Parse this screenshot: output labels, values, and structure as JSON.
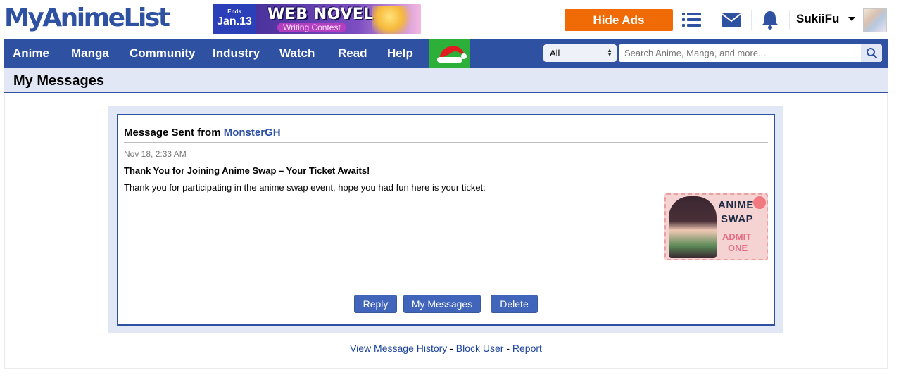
{
  "header": {
    "logo": "MyAnimeList",
    "banner": {
      "ends_label": "Ends",
      "ends_date": "Jan.13",
      "title": "WEB NOVEL",
      "subtitle": "Writing Contest"
    },
    "hide_ads_label": "Hide Ads",
    "username": "SukiiFu"
  },
  "nav": {
    "items": [
      "Anime",
      "Manga",
      "Community",
      "Industry",
      "Watch",
      "Read",
      "Help"
    ],
    "search_select": "All",
    "search_placeholder": "Search Anime, Manga, and more..."
  },
  "page": {
    "title": "My Messages"
  },
  "message": {
    "header_prefix": "Message Sent from ",
    "sender": "MonsterGH",
    "date": "Nov 18, 2:33 AM",
    "subject": "Thank You for Joining Anime Swap – Your Ticket Awaits!",
    "body": "Thank you for participating in the anime swap event, hope you had fun here is your ticket:",
    "ticket": {
      "line1": "ANIME",
      "line2": "SWAP",
      "line3": "ADMIT",
      "line4": "ONE"
    },
    "buttons": {
      "reply": "Reply",
      "my_messages": "My Messages",
      "delete": "Delete"
    }
  },
  "footer": {
    "view_history": "View Message History",
    "sep1": " - ",
    "block_user": "Block User",
    "sep2": " - ",
    "report": "Report"
  },
  "colors": {
    "brand_blue": "#2e51a2",
    "hide_ads_orange": "#f06b06",
    "button_blue": "#4165ba",
    "light_panel": "#e1e7f5",
    "santa_green": "#2db039"
  }
}
